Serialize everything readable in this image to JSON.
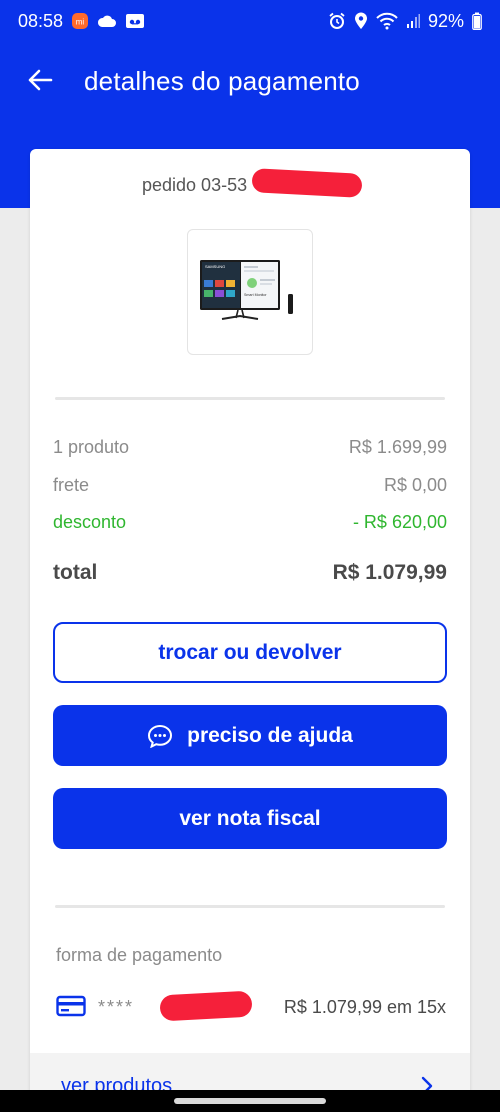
{
  "status": {
    "time": "08:58",
    "battery": "92%",
    "left_icons": [
      "app-notification-icon",
      "cloud-icon",
      "voicemail-icon"
    ],
    "right_icons": [
      "alarm-icon",
      "location-icon",
      "wifi-icon",
      "signal-icon",
      "battery-icon"
    ]
  },
  "header": {
    "title": "detalhes do pagamento",
    "back_icon": "arrow-left-icon"
  },
  "order": {
    "label": "pedido 03-53"
  },
  "product": {
    "image_brand": "SAMSUNG",
    "image_caption": "Smart Monitor"
  },
  "summary": {
    "products_label": "1 produto",
    "products_value": "R$ 1.699,99",
    "shipping_label": "frete",
    "shipping_value": "R$ 0,00",
    "discount_label": "desconto",
    "discount_value": "- R$ 620,00",
    "total_label": "total",
    "total_value": "R$ 1.079,99"
  },
  "actions": {
    "exchange_label": "trocar ou devolver",
    "help_label": "preciso de ajuda",
    "invoice_label": "ver nota fiscal"
  },
  "payment": {
    "section_label": "forma de pagamento",
    "card_masked": "****",
    "amount": "R$ 1.079,99 em 15x"
  },
  "footer": {
    "see_products_label": "ver produtos"
  },
  "colors": {
    "brand_blue": "#0a33ea",
    "discount_green": "#2fb62f",
    "redaction_red": "#f5203a"
  }
}
